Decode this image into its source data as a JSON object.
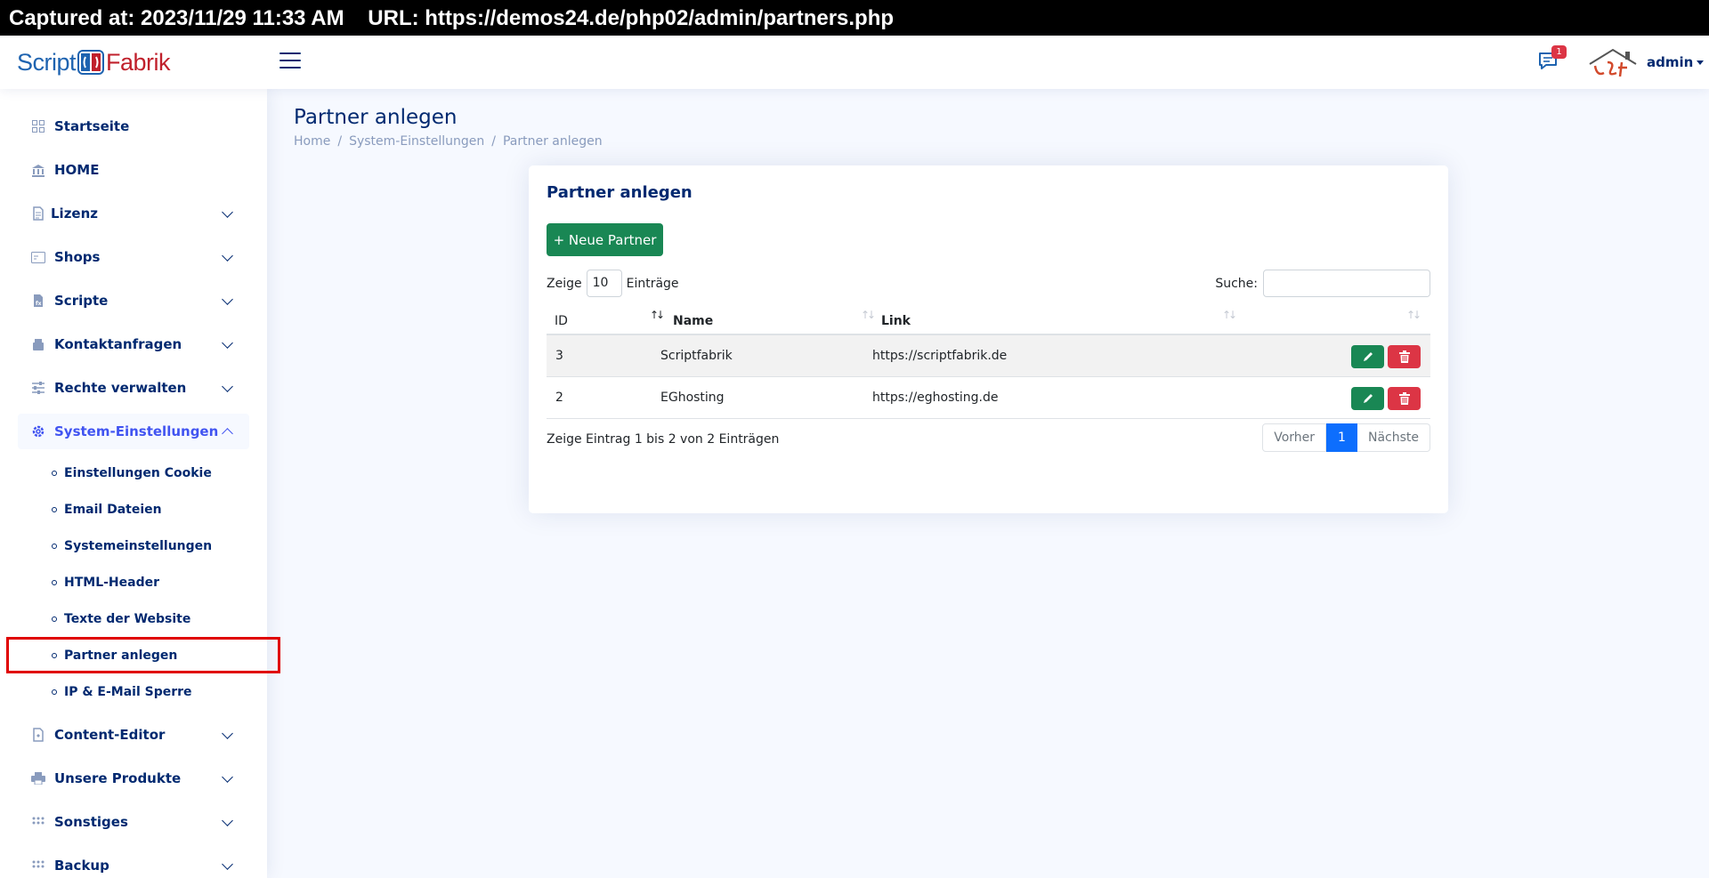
{
  "capture": {
    "text": "Captured at: 2023/11/29 11:33 AM    URL: https://demos24.de/php02/admin/partners.php"
  },
  "header": {
    "logo_left": "Script",
    "logo_right": "Fabrik",
    "notification_count": "1",
    "user_name": "admin"
  },
  "sidebar": {
    "items": [
      {
        "label": "Startseite",
        "icon": "grid-icon"
      },
      {
        "label": "HOME",
        "icon": "bank-icon"
      },
      {
        "label": "Lizenz",
        "icon": "document-icon"
      },
      {
        "label": "Shops",
        "icon": "card-icon"
      },
      {
        "label": "Scripte",
        "icon": "file-code-icon"
      },
      {
        "label": "Kontaktanfragen",
        "icon": "inbox-icon"
      },
      {
        "label": "Rechte verwalten",
        "icon": "sliders-icon"
      },
      {
        "label": "System-Einstellungen",
        "icon": "gear-icon"
      },
      {
        "label": "Content-Editor",
        "icon": "file-icon"
      },
      {
        "label": "Unsere Produkte",
        "icon": "printer-icon"
      },
      {
        "label": "Sonstiges",
        "icon": "dots-grid-icon"
      },
      {
        "label": "Backup",
        "icon": "dots-grid-icon"
      }
    ],
    "sub_items": [
      {
        "label": "Einstellungen Cookie"
      },
      {
        "label": "Email Dateien"
      },
      {
        "label": "Systemeinstellungen"
      },
      {
        "label": "HTML-Header"
      },
      {
        "label": "Texte der Website"
      },
      {
        "label": "Partner anlegen"
      },
      {
        "label": "IP & E-Mail Sperre"
      }
    ]
  },
  "main": {
    "page_title": "Partner anlegen",
    "breadcrumb": [
      "Home",
      "System-Einstellungen",
      "Partner anlegen"
    ],
    "card_title": "Partner anlegen",
    "new_button": "+ Neue Partner",
    "length": {
      "before": "Zeige",
      "value": "10",
      "after": "Einträge"
    },
    "search_label": "Suche:",
    "search_value": "",
    "columns": [
      "ID",
      "Name",
      "Link"
    ],
    "rows": [
      {
        "id": "3",
        "name": "Scriptfabrik",
        "link": "https://scriptfabrik.de"
      },
      {
        "id": "2",
        "name": "EGhosting",
        "link": "https://eghosting.de"
      }
    ],
    "info": "Zeige Eintrag 1 bis 2 von 2 Einträgen",
    "pager": {
      "prev": "Vorher",
      "current": "1",
      "next": "Nächste"
    }
  },
  "colors": {
    "accent": "#4154f1",
    "text_dark": "#012970",
    "success": "#198754",
    "danger": "#dc3545",
    "page_bg": "#f6f9ff",
    "highlight": "#e00000"
  }
}
